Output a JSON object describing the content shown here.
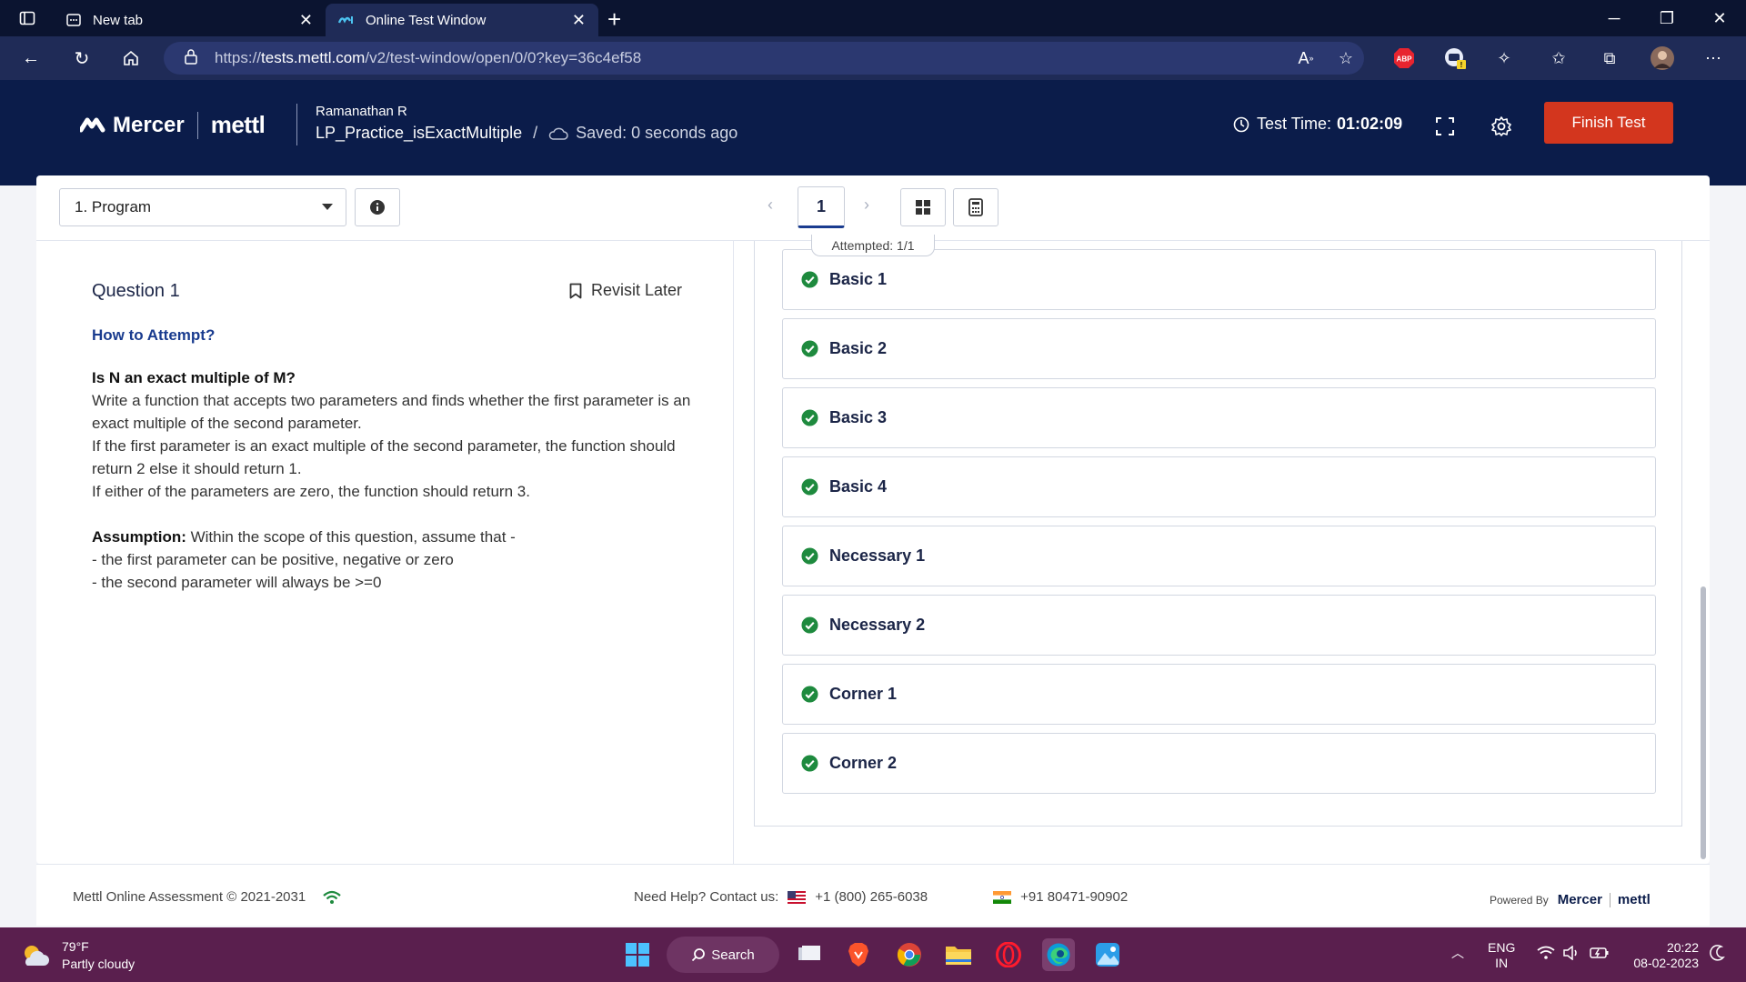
{
  "browser": {
    "tabs": [
      {
        "label": "New tab",
        "active": false
      },
      {
        "label": "Online Test Window",
        "active": true
      }
    ],
    "url_prefix": "https://",
    "url_host": "tests.mettl.com",
    "url_path": "/v2/test-window/open/0/0?key=36c4ef58",
    "extensions": [
      "read-aloud-icon",
      "add-favorite-icon",
      "adblock-plus-icon",
      "copilot-extension-icon",
      "extensions-icon",
      "favorites-icon",
      "collections-icon",
      "profile-avatar",
      "more-menu-icon"
    ]
  },
  "header": {
    "brand_mercer": "Mercer",
    "brand_mettl": "mettl",
    "candidate": "Ramanathan R",
    "test_name": "LP_Practice_isExactMultiple",
    "separator": "/",
    "saved_status": "Saved: 0 seconds ago",
    "timer_label": "Test Time:",
    "timer_value": "01:02:09",
    "finish_label": "Finish Test"
  },
  "toolbar": {
    "section": "1. Program",
    "prev": "‹",
    "next": "›",
    "current_question": "1",
    "attempted": "Attempted: 1/1"
  },
  "question": {
    "title": "Question 1",
    "revisit_label": "Revisit Later",
    "how_to": "How to Attempt?",
    "heading": "Is N an exact multiple of M?",
    "line1": "Write a function that accepts two parameters and finds whether the first parameter is an exact multiple of the second parameter.",
    "line2": "If the first parameter is an exact multiple of the second parameter, the function should return 2 else it should return 1.",
    "line3": "If either of the parameters are zero, the function should return 3.",
    "assumption_label": "Assumption:",
    "assumption_text": " Within the scope of this question, assume that -",
    "bullet1": "- the first parameter can be positive, negative or zero",
    "bullet2": "- the second parameter will always be >=0"
  },
  "test_cases": [
    {
      "label": "Basic 1",
      "status": "passed"
    },
    {
      "label": "Basic 2",
      "status": "passed"
    },
    {
      "label": "Basic 3",
      "status": "passed"
    },
    {
      "label": "Basic 4",
      "status": "passed"
    },
    {
      "label": "Necessary 1",
      "status": "passed"
    },
    {
      "label": "Necessary 2",
      "status": "passed"
    },
    {
      "label": "Corner 1",
      "status": "passed"
    },
    {
      "label": "Corner 2",
      "status": "passed"
    }
  ],
  "footer": {
    "copyright": "Mettl Online Assessment © 2021-2031",
    "help_label": "Need Help? Contact us:",
    "phone_us": "+1 (800) 265-6038",
    "phone_in": "+91 80471-90902",
    "powered_by": "Powered By",
    "pb_mercer": "Mercer",
    "pb_mettl": "mettl"
  },
  "taskbar": {
    "temperature": "79°F",
    "condition": "Partly cloudy",
    "search_label": "Search",
    "lang1": "ENG",
    "lang2": "IN",
    "time": "20:22",
    "date": "08-02-2023"
  },
  "colors": {
    "header_bg": "#0b1c4a",
    "finish_button": "#d3361e",
    "accent_blue": "#1a3c8f",
    "pass_green": "#1e8a3e",
    "taskbar_bg": "#5a1f4e"
  }
}
